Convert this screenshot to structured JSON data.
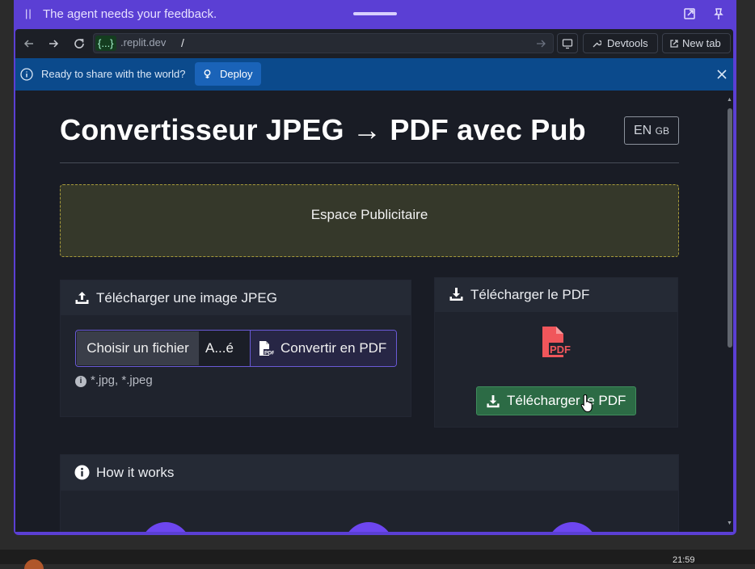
{
  "agent_bar": {
    "message": "The agent needs your feedback."
  },
  "browser": {
    "url_host": "{...}",
    "url_domain": ".replit.dev",
    "url_path": "/",
    "devtools_label": "Devtools",
    "new_tab_label": "New tab"
  },
  "info_bar": {
    "message": "Ready to share with the world?",
    "deploy_label": "Deploy"
  },
  "page": {
    "title": "Convertisseur JPEG → PDF avec Pub",
    "lang_label": "EN",
    "lang_flag": "GB",
    "ad_text": "Espace Publicitaire",
    "upload_card": {
      "title": "Télécharger une image JPEG",
      "choose_label": "Choisir un fichier",
      "file_name": "A...é",
      "convert_label": "Convertir en PDF",
      "hint": "*.jpg, *.jpeg"
    },
    "download_card": {
      "title": "Télécharger le PDF",
      "button_label": "Télécharger le PDF"
    },
    "how_card": {
      "title": "How it works"
    }
  },
  "taskbar": {
    "time": "21:59"
  },
  "colors": {
    "agent_bar": "#5b3fd4",
    "info_bar": "#0b4a8c",
    "page_bg": "#191c25",
    "card_bg": "#1f232d",
    "ad_bg": "#35382a",
    "ad_border": "#a79a3a",
    "pdf_red": "#f0565b",
    "download_green": "#2c6b45",
    "step_circle": "#6d46f0"
  },
  "icons": [
    "pause-icon",
    "drag-handle",
    "popout-icon",
    "pin-icon",
    "back-icon",
    "forward-icon",
    "reload-icon",
    "go-icon",
    "screen-icon",
    "wrench-icon",
    "external-link-icon",
    "info-icon",
    "deploy-icon",
    "close-icon",
    "upload-icon",
    "pdf-file-icon",
    "download-icon",
    "cursor-hand-icon"
  ]
}
